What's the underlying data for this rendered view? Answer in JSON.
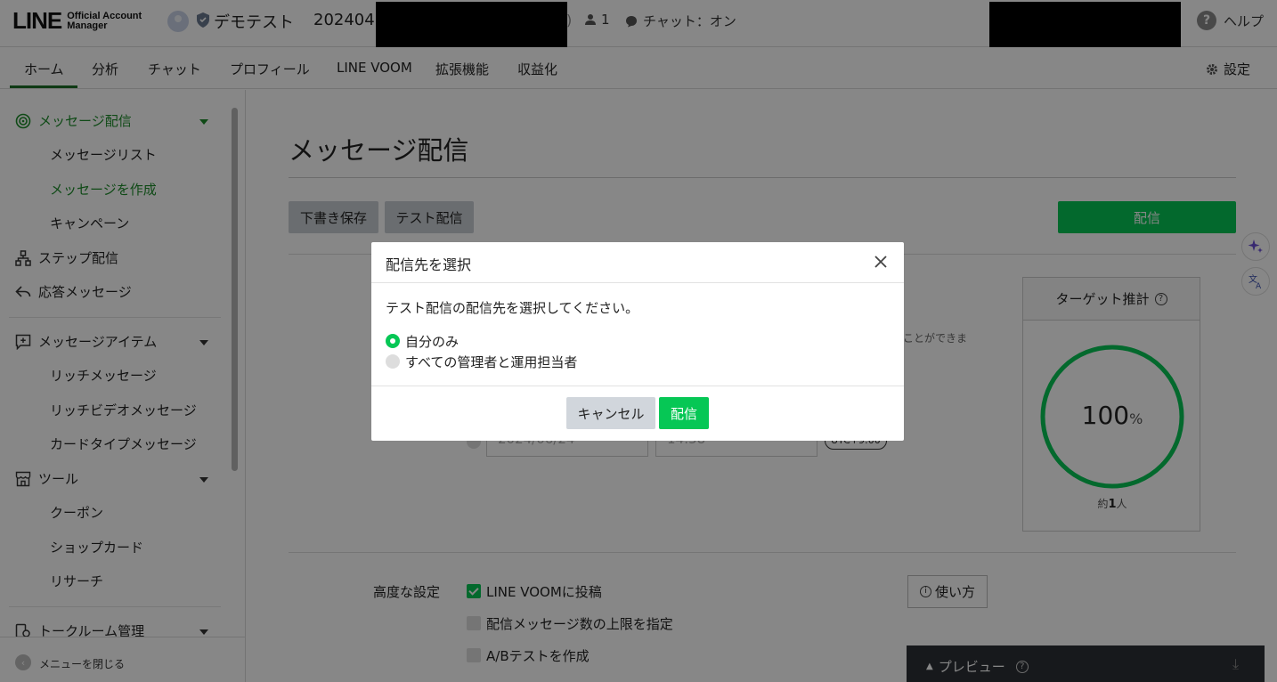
{
  "header": {
    "logo_text": "LINE",
    "logo_sub_1": "Official Account",
    "logo_sub_2": "Manager",
    "account_name": "デモテスト",
    "account_id": "202404",
    "paren": ")",
    "friends_count": "1",
    "chat_status": "チャット：オン",
    "help_label": "ヘルプ"
  },
  "nav": {
    "tabs": [
      {
        "label": "ホーム"
      },
      {
        "label": "分析"
      },
      {
        "label": "チャット"
      },
      {
        "label": "プロフィール"
      },
      {
        "label": "LINE VOOM"
      },
      {
        "label": "拡張機能"
      },
      {
        "label": "収益化"
      }
    ],
    "active_tab": "ホーム",
    "settings_label": "設定"
  },
  "sidebar": {
    "message_delivery": "メッセージ配信",
    "message_list": "メッセージリスト",
    "create_message": "メッセージを作成",
    "campaign": "キャンペーン",
    "step_delivery": "ステップ配信",
    "auto_reply": "応答メッセージ",
    "message_items": "メッセージアイテム",
    "rich_message": "リッチメッセージ",
    "rich_video": "リッチビデオメッセージ",
    "card_type": "カードタイプメッセージ",
    "tools": "ツール",
    "coupon": "クーポン",
    "shop_card": "ショップカード",
    "research": "リサーチ",
    "talk_room": "トークルーム管理",
    "close_menu": "メニューを閉じる"
  },
  "main": {
    "page_title": "メッセージ配信",
    "save_draft": "下書き保存",
    "test_send": "テスト配信",
    "send": "配信",
    "bg_text": "ことができま",
    "date_value": "2024/06/24",
    "time_value": "14:58",
    "utc": "UTC+9:00",
    "target": {
      "title": "ターゲット推計",
      "percent": "100",
      "percent_unit": "%",
      "percent_value": 100,
      "count_prefix": "約",
      "count": "1",
      "count_suffix": "人"
    },
    "advanced_label": "高度な設定",
    "options": [
      {
        "label": "LINE VOOMに投稿",
        "checked": true
      },
      {
        "label": "配信メッセージ数の上限を指定",
        "checked": false
      },
      {
        "label": "A/Bテストを作成",
        "checked": false
      }
    ],
    "howto": "使い方",
    "preview": "プレビュー"
  },
  "modal": {
    "title": "配信先を選択",
    "description": "テスト配信の配信先を選択してください。",
    "options": [
      {
        "label": "自分のみ",
        "selected": true
      },
      {
        "label": "すべての管理者と運用担当者",
        "selected": false
      }
    ],
    "cancel": "キャンセル",
    "send": "配信"
  },
  "colors": {
    "brand_green": "#06c755",
    "active_green": "#1d8c2b",
    "overlay": "rgba(0,0,0,0.47)"
  }
}
